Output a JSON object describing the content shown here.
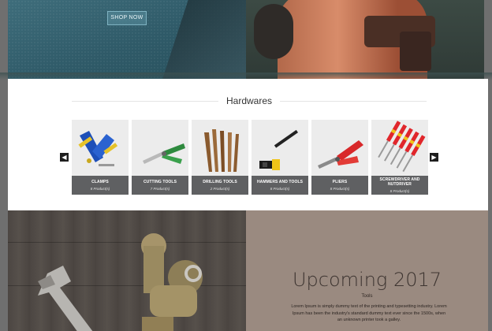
{
  "hero": {
    "shop_button": "SHOP NOW"
  },
  "hardwares": {
    "title": "Hardwares",
    "prev_icon": "chevron-left-icon",
    "next_icon": "chevron-right-icon",
    "products": [
      {
        "name": "CLAMPS",
        "count": "8 Product(s)"
      },
      {
        "name": "CUTTING TOOLS",
        "count": "7 Product(s)"
      },
      {
        "name": "DRILLING TOOLS",
        "count": "2 Product(s)"
      },
      {
        "name": "HAMMERS AND TOOLS",
        "count": "8 Product(s)"
      },
      {
        "name": "PLIERS",
        "count": "8 Product(s)"
      },
      {
        "name": "SCREWDRIVER AND NUTDRIVER",
        "count": "8 Product(s)"
      }
    ]
  },
  "promo": {
    "heading": "Upcoming 2017",
    "subheading": "Tools",
    "body": "Lorem Ipsum is simply dummy text of the printing and typesetting industry. Lorem Ipsum has been the industry's standard dummy text ever since the 1500s, when an unknown printer took a galley."
  },
  "colors": {
    "panel_bg": "#ffffff",
    "caption_bg": "#5f6062",
    "card_bg": "#ececec",
    "promo_bg": "#9a8a80"
  }
}
